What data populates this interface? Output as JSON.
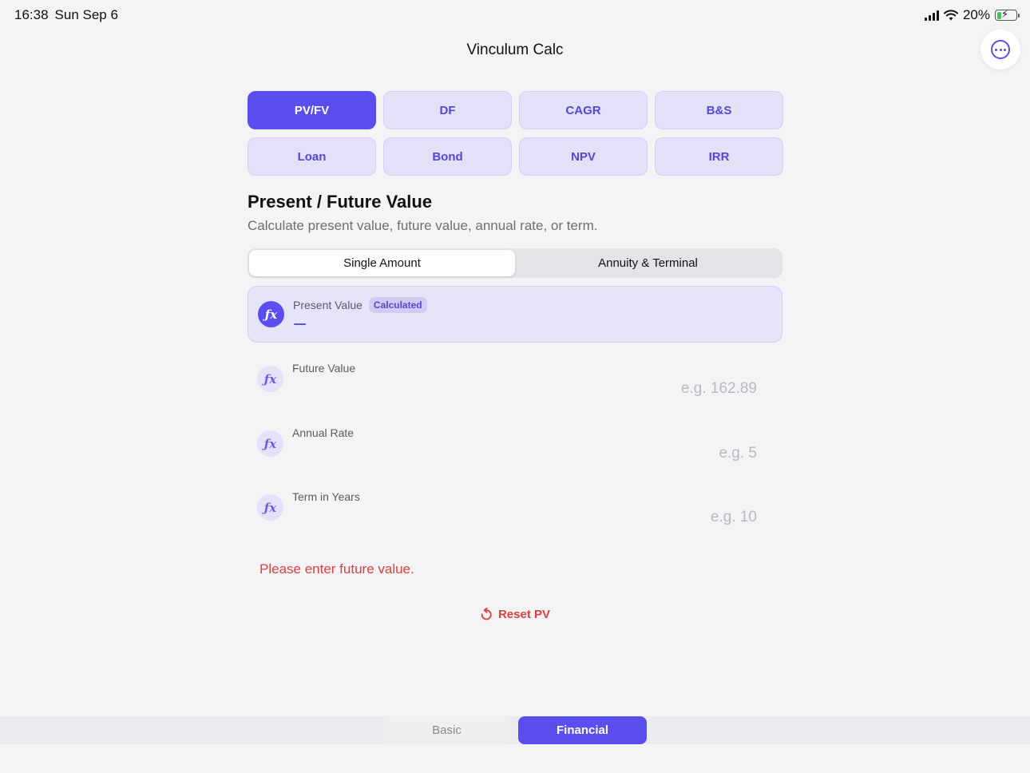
{
  "status_bar": {
    "time": "16:38",
    "date": "Sun Sep 6",
    "battery_percent": "20%"
  },
  "app": {
    "title": "Vinculum Calc"
  },
  "tools": [
    {
      "label": "PV/FV",
      "active": true
    },
    {
      "label": "DF",
      "active": false
    },
    {
      "label": "CAGR",
      "active": false
    },
    {
      "label": "B&S",
      "active": false
    },
    {
      "label": "Loan",
      "active": false
    },
    {
      "label": "Bond",
      "active": false
    },
    {
      "label": "NPV",
      "active": false
    },
    {
      "label": "IRR",
      "active": false
    }
  ],
  "section": {
    "title": "Present / Future Value",
    "subtitle": "Calculate present value, future value, annual rate, or term."
  },
  "segment": {
    "options": [
      "Single Amount",
      "Annuity & Terminal"
    ],
    "selected": "Single Amount"
  },
  "fields": {
    "present_value": {
      "label": "Present Value",
      "badge": "Calculated",
      "value": ""
    },
    "future_value": {
      "label": "Future Value",
      "placeholder": "e.g. 162.89",
      "value": ""
    },
    "annual_rate": {
      "label": "Annual Rate",
      "placeholder": "e.g. 5",
      "value": ""
    },
    "term": {
      "label": "Term in Years",
      "placeholder": "e.g. 10",
      "value": ""
    }
  },
  "error_message": "Please enter future value.",
  "reset_label": "Reset PV",
  "modes": {
    "basic": "Basic",
    "financial": "Financial",
    "selected": "Financial"
  },
  "colors": {
    "accent": "#5b4ef0",
    "accent_soft": "#e3e1f8",
    "error": "#e0403a"
  },
  "icons": {
    "more": "ellipsis-circle-icon",
    "fx": "function-fx-icon",
    "reset": "reset-arrow-icon"
  }
}
